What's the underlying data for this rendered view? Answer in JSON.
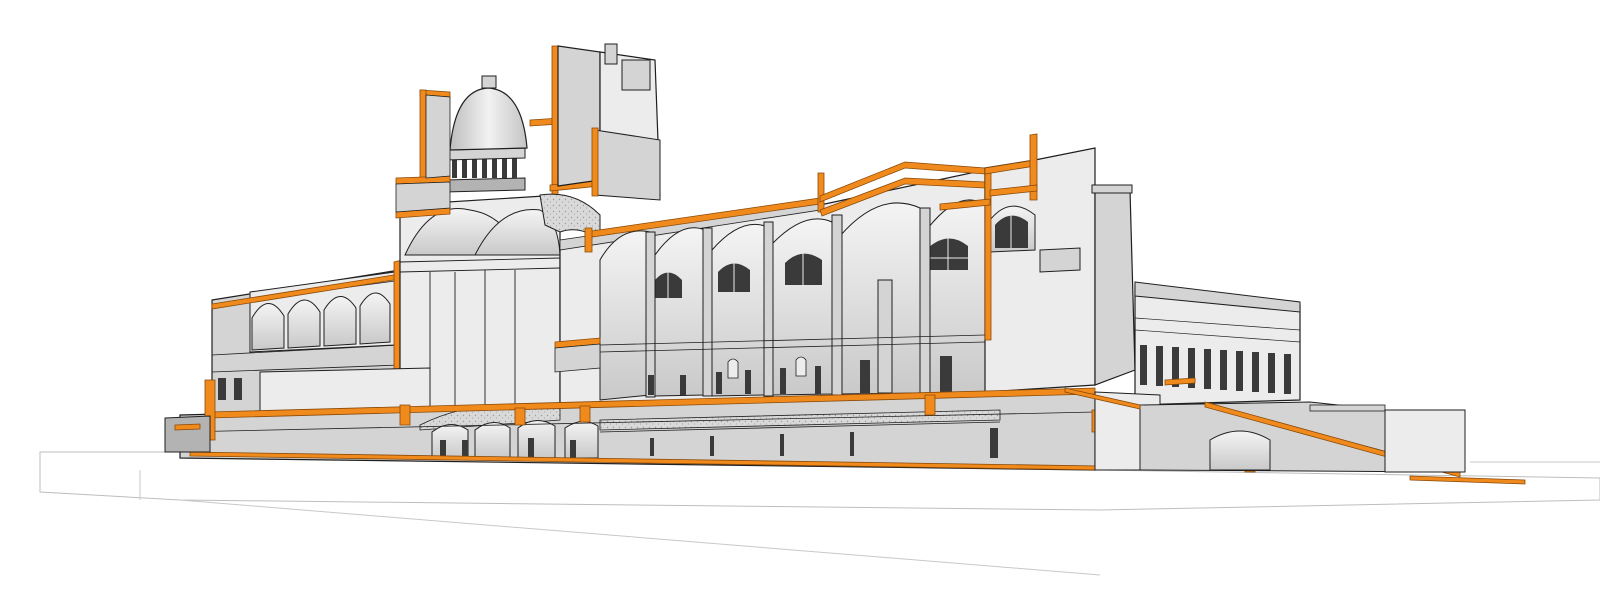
{
  "drawing": {
    "colors": {
      "background": "#ffffff",
      "cut": "#f08a1c",
      "cut_edge": "#8a4a08",
      "line": "#1f1f1f",
      "wall_light": "#ececec",
      "wall_mid": "#d4d4d4",
      "wall_dark": "#b3b3b3",
      "shadow": "#8f8f8f",
      "glass": "#3a3a3a",
      "texture": "#bdbdbd"
    }
  }
}
